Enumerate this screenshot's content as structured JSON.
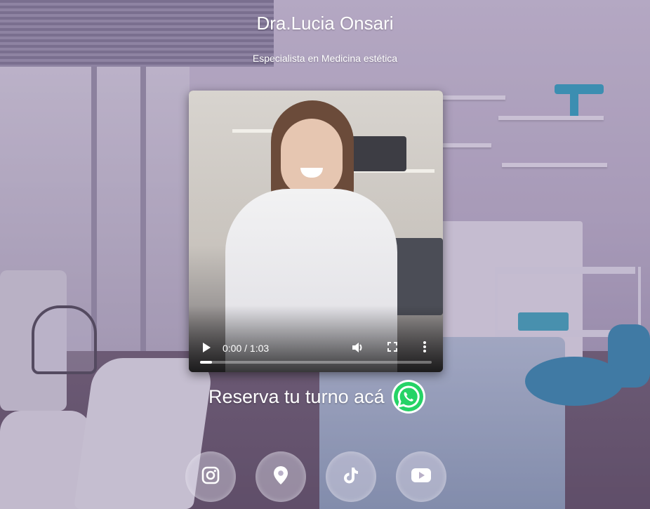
{
  "header": {
    "title": "Dra.Lucia Onsari",
    "subtitle": "Especialista en Medicina estética"
  },
  "video": {
    "time": "0:00 / 1:03",
    "progress": 0.05,
    "icons": [
      "play-icon",
      "volume-icon",
      "fullscreen-icon",
      "more-options-icon"
    ]
  },
  "cta": {
    "label": "Reserva tu turno acá",
    "icon": "whatsapp-icon",
    "icon_color": "#25D366"
  },
  "socials": [
    {
      "name": "instagram",
      "icon": "instagram-icon"
    },
    {
      "name": "location",
      "icon": "location-pin-icon"
    },
    {
      "name": "tiktok",
      "icon": "tiktok-icon"
    },
    {
      "name": "youtube",
      "icon": "youtube-icon"
    }
  ],
  "colors": {
    "overlay": "#6e5a8c",
    "text": "#ffffff",
    "whatsapp": "#25D366"
  }
}
